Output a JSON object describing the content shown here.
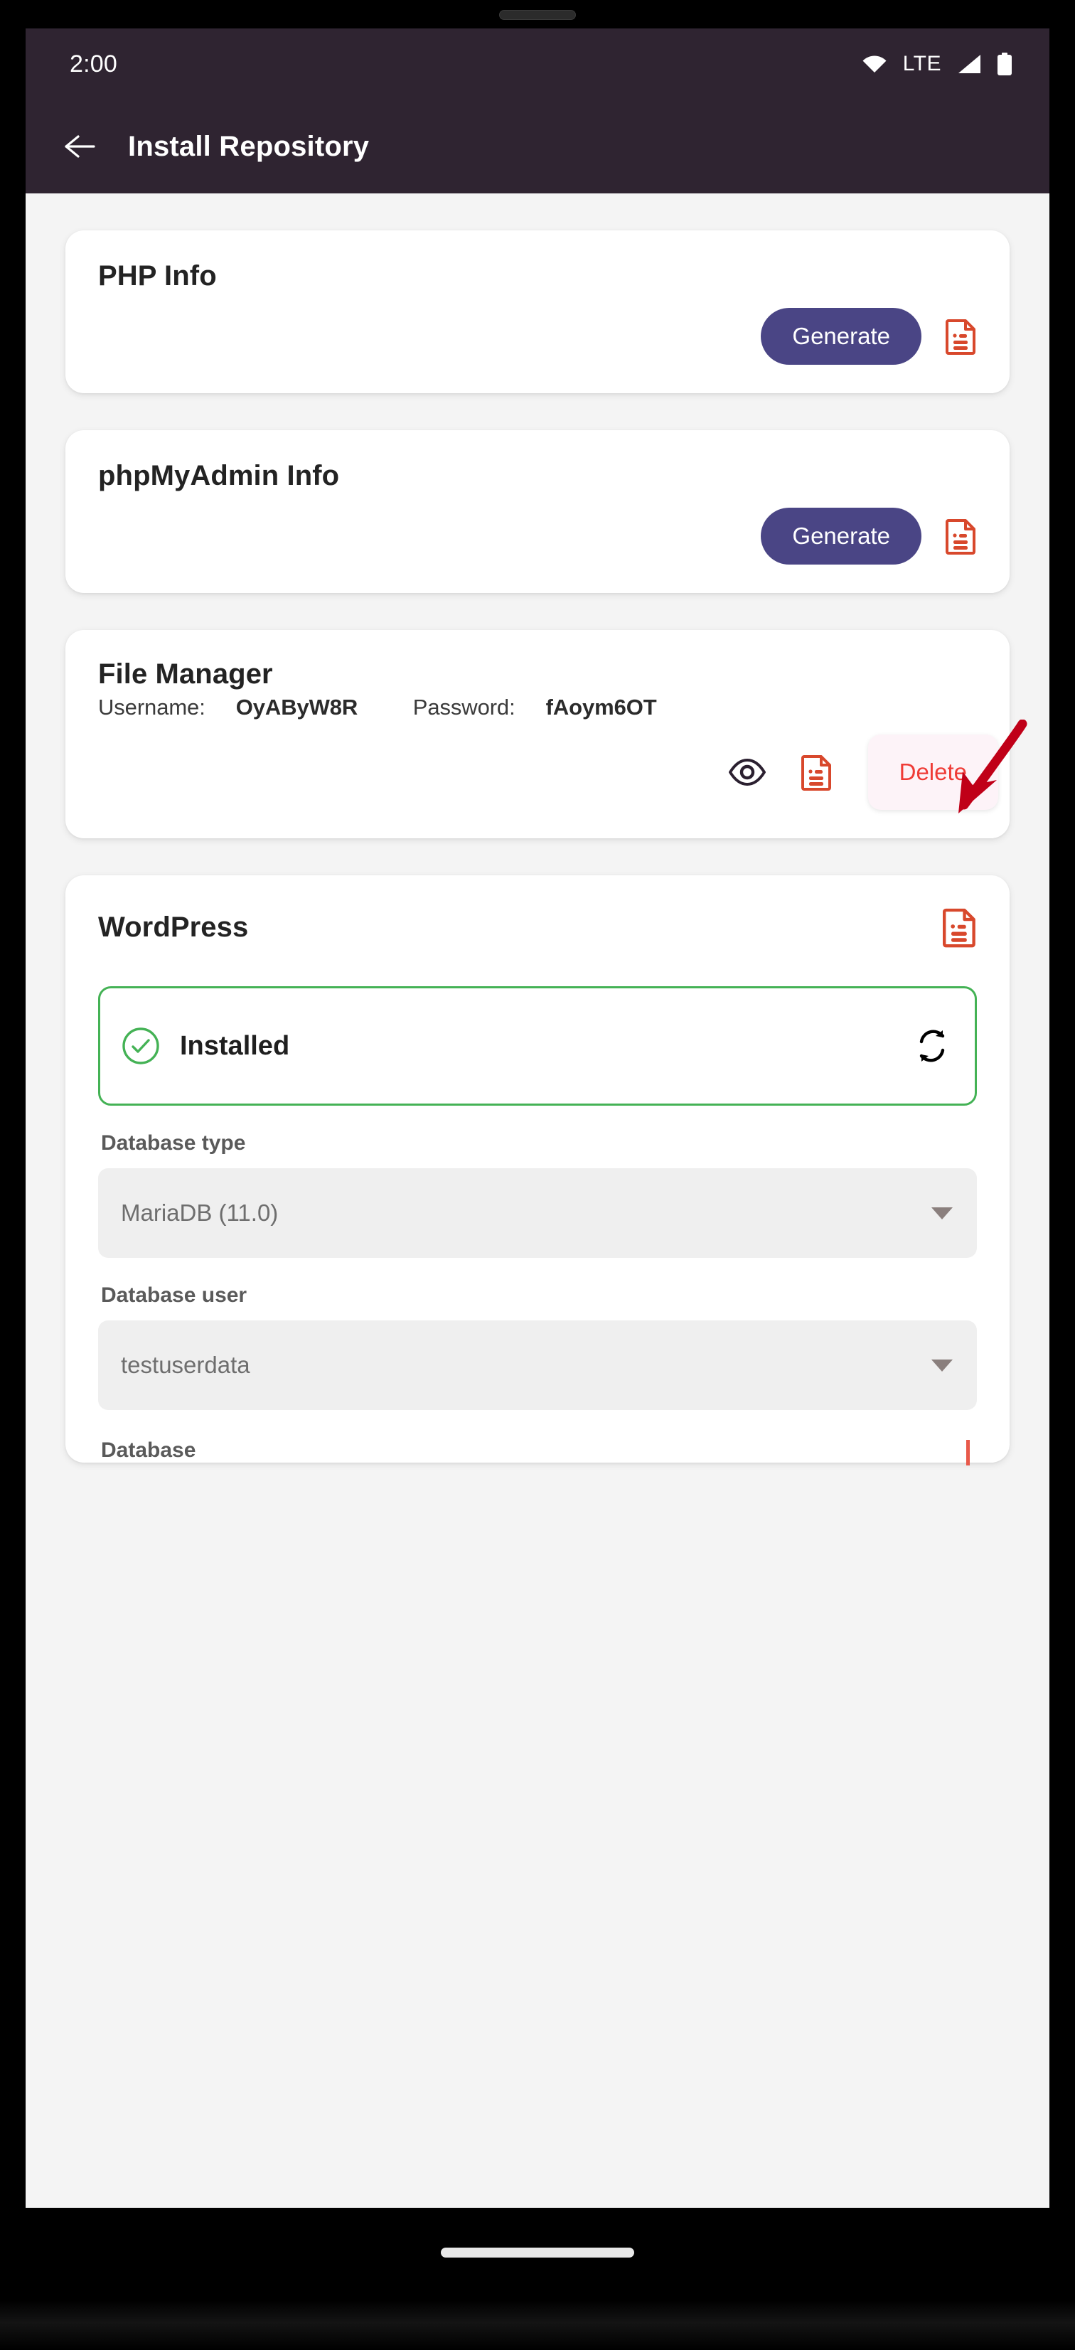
{
  "status_bar": {
    "clock": "2:00",
    "network_label": "LTE",
    "icons": [
      "wifi-icon",
      "signal-icon",
      "battery-icon"
    ]
  },
  "app_bar": {
    "back_icon": "arrow-left-icon",
    "title": "Install Repository"
  },
  "theme": {
    "appbar_bg": "#2f2431",
    "page_bg": "#f4f4f4",
    "card_bg": "#ffffff",
    "primary": "#4a4585",
    "doc_icon": "#d8482c",
    "success": "#44b255",
    "danger": "#ef3b36",
    "annotation": "#c00018"
  },
  "cards": {
    "php_info": {
      "title": "PHP Info",
      "generate_label": "Generate",
      "doc_icon": "document-icon"
    },
    "phpmyadmin_info": {
      "title": "phpMyAdmin Info",
      "generate_label": "Generate",
      "doc_icon": "document-icon"
    },
    "file_manager": {
      "title": "File Manager",
      "username_label": "Username:",
      "username_value": "OyAByW8R",
      "password_label": "Password:",
      "password_value": "fAoym6OT",
      "eye_icon": "eye-icon",
      "doc_icon": "document-icon",
      "delete_label": "Delete"
    },
    "wordpress": {
      "title": "WordPress",
      "doc_icon": "document-icon",
      "status_text": "Installed",
      "status_icon": "check-circle-icon",
      "refresh_icon": "refresh-icon",
      "fields": [
        {
          "label": "Database type",
          "value": "MariaDB (11.0)",
          "caret": "chevron-down-icon"
        },
        {
          "label": "Database user",
          "value": "testuserdata",
          "caret": "chevron-down-icon"
        }
      ],
      "cut_off_label": "Database"
    }
  },
  "annotation": {
    "type": "arrow",
    "points_to": "delete-button",
    "color": "#c00018"
  }
}
